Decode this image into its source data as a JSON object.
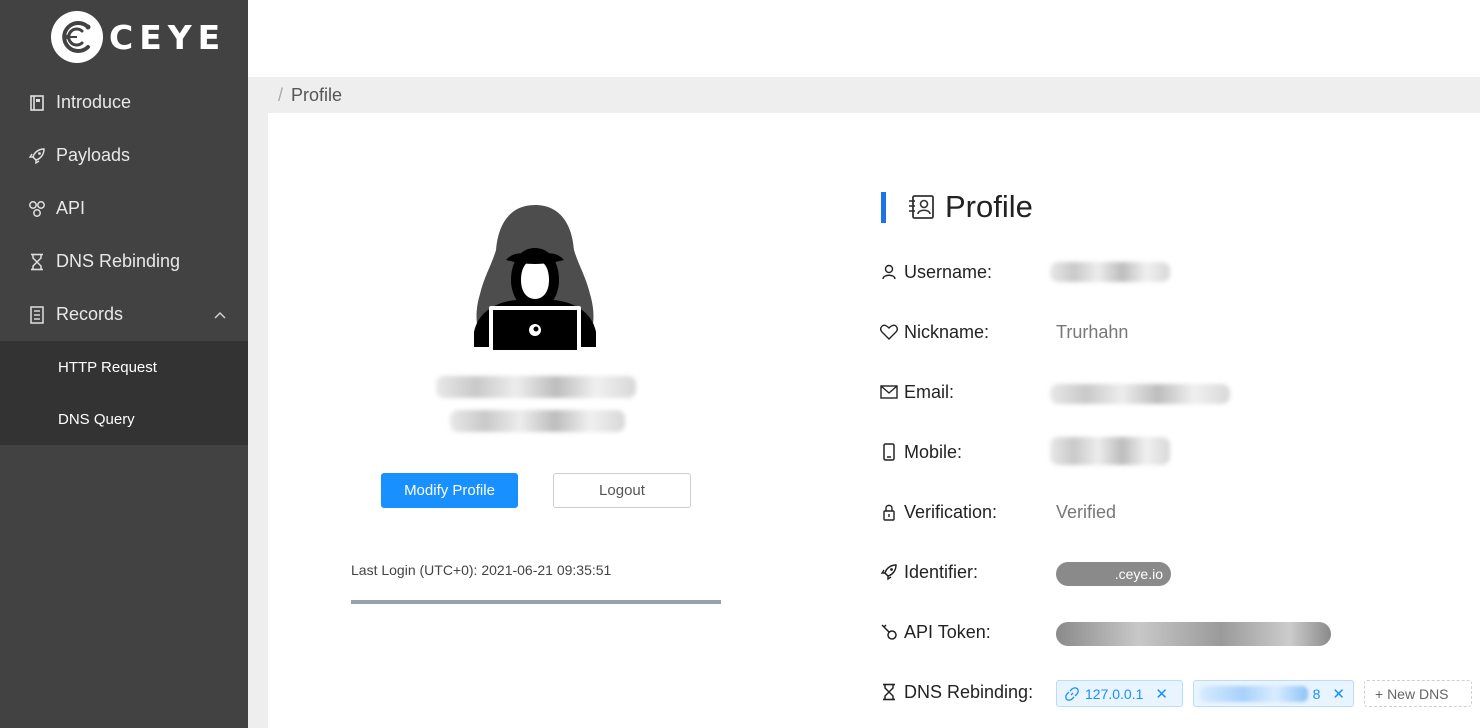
{
  "brand": {
    "name": "CEYE"
  },
  "sidebar": {
    "items": [
      {
        "label": "Introduce",
        "icon": "book-icon"
      },
      {
        "label": "Payloads",
        "icon": "rocket-icon"
      },
      {
        "label": "API",
        "icon": "api-icon"
      },
      {
        "label": "DNS Rebinding",
        "icon": "hourglass-icon"
      },
      {
        "label": "Records",
        "icon": "records-icon",
        "expanded": true
      }
    ],
    "sub_items": [
      {
        "label": "HTTP Request"
      },
      {
        "label": "DNS Query"
      }
    ]
  },
  "breadcrumb": {
    "separator": "/",
    "current": "Profile"
  },
  "left_panel": {
    "modify_label": "Modify Profile",
    "logout_label": "Logout",
    "last_login": "Last Login (UTC+0): 2021-06-21 09:35:51",
    "progress_percent": 100
  },
  "profile": {
    "title": "Profile",
    "fields": {
      "username_label": "Username:",
      "nickname_label": "Nickname:",
      "nickname_value": "Trurhahn",
      "email_label": "Email:",
      "mobile_label": "Mobile:",
      "verification_label": "Verification:",
      "verification_value": "Verified",
      "identifier_label": "Identifier:",
      "identifier_suffix": ".ceye.io",
      "api_token_label": "API Token:",
      "dns_rebinding_label": "DNS Rebinding:"
    },
    "dns_tags": [
      {
        "label": "127.0.0.1",
        "close": "✕"
      },
      {
        "label": "8",
        "close": "✕"
      }
    ],
    "new_dns_label": "+ New DNS"
  },
  "colors": {
    "sidebar_bg": "#424242",
    "submenu_bg": "#333333",
    "primary": "#1890ff",
    "section_accent": "#1a73e8"
  }
}
